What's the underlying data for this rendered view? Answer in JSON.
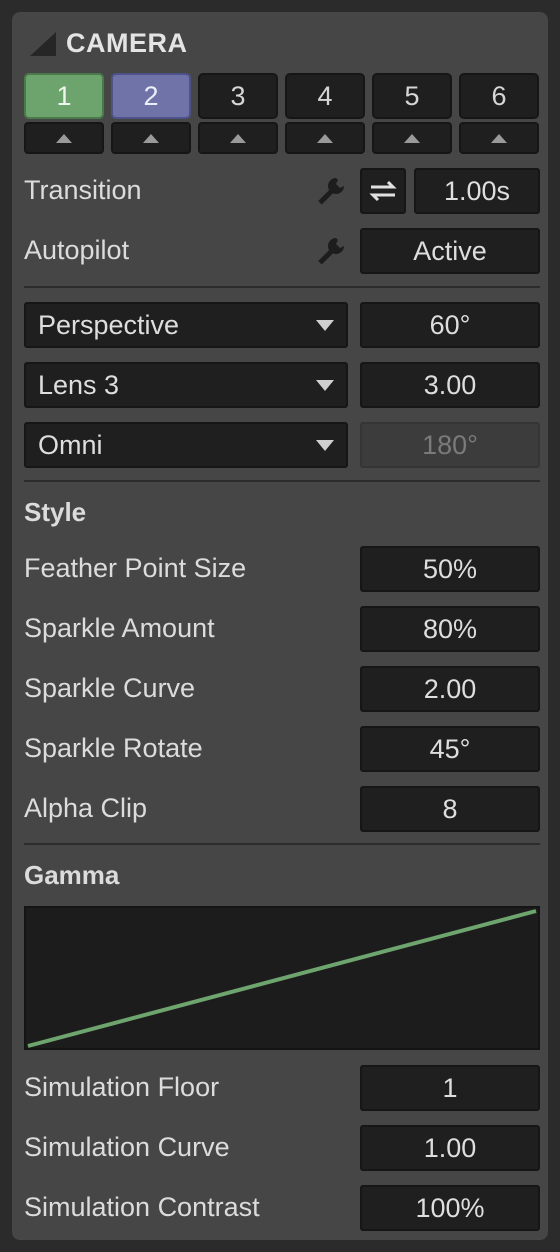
{
  "header": {
    "title": "CAMERA",
    "collapse_icon": "triangle-corner-icon"
  },
  "cameras": [
    {
      "label": "1",
      "state": "active-green",
      "color": "#6da46d"
    },
    {
      "label": "2",
      "state": "active-blue",
      "color": "#6f73a8"
    },
    {
      "label": "3",
      "state": "normal"
    },
    {
      "label": "4",
      "state": "normal"
    },
    {
      "label": "5",
      "state": "normal"
    },
    {
      "label": "6",
      "state": "normal"
    }
  ],
  "transition": {
    "label": "Transition",
    "value": "1.00s",
    "icons": [
      "wrench-icon",
      "swap-arrows-icon"
    ]
  },
  "autopilot": {
    "label": "Autopilot",
    "value": "Active",
    "icon": "wrench-icon"
  },
  "projection": {
    "selected": "Perspective",
    "value": "60°"
  },
  "lens": {
    "selected": "Lens 3",
    "value": "3.00"
  },
  "light": {
    "selected": "Omni",
    "value": "180°",
    "disabled": true
  },
  "style": {
    "heading": "Style",
    "rows": [
      {
        "label": "Feather Point Size",
        "value": "50%"
      },
      {
        "label": "Sparkle Amount",
        "value": "80%"
      },
      {
        "label": "Sparkle Curve",
        "value": "2.00"
      },
      {
        "label": "Sparkle Rotate",
        "value": "45°"
      },
      {
        "label": "Alpha Clip",
        "value": "8"
      }
    ]
  },
  "gamma": {
    "heading": "Gamma",
    "curve_color": "#6ea46e"
  },
  "simulation": {
    "rows": [
      {
        "label": "Simulation Floor",
        "value": "1"
      },
      {
        "label": "Simulation Curve",
        "value": "1.00"
      },
      {
        "label": "Simulation Contrast",
        "value": "100%"
      }
    ]
  }
}
